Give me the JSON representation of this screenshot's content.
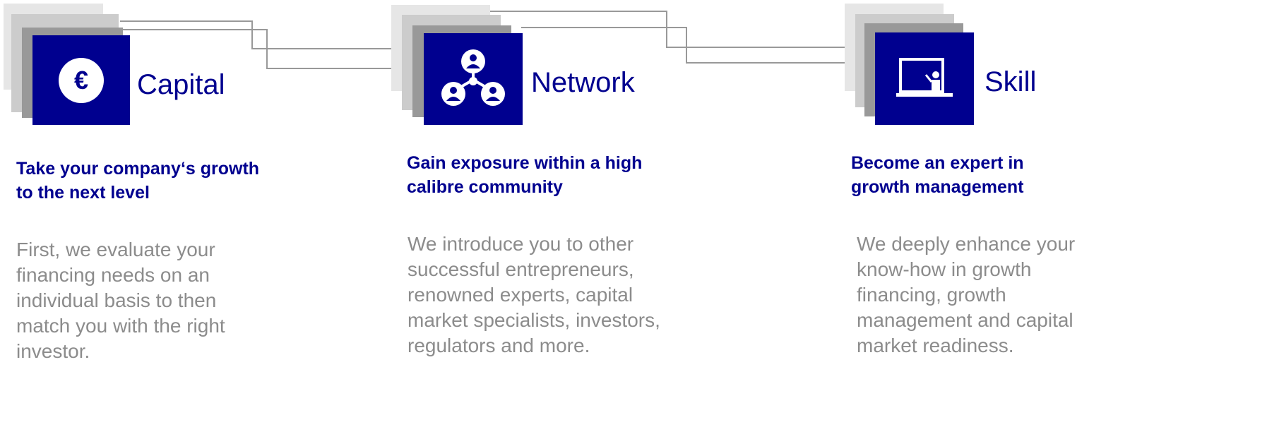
{
  "brand_colors": {
    "primary": "#00008f",
    "body_text": "#8c8c8c",
    "stack_layers": [
      "#e6e6e6",
      "#cccccc",
      "#999999"
    ],
    "connector": "#999999"
  },
  "pillars": [
    {
      "label": "Capital",
      "icon": "euro-coin-icon",
      "headline": "Take your company‘s growth to the next level",
      "body": "First, we evaluate your financing needs on an individual basis to then match you with the right investor."
    },
    {
      "label": "Network",
      "icon": "people-network-icon",
      "headline": "Gain exposure within a high calibre community",
      "body": "We introduce you to other successful entrepreneurs, renowned experts, capital market specialists, investors, regulators and more."
    },
    {
      "label": "Skill",
      "icon": "teacher-board-icon",
      "headline": "Become an expert in growth management",
      "body": "We deeply enhance your know-how in growth financing, growth management and capital market readiness."
    }
  ]
}
